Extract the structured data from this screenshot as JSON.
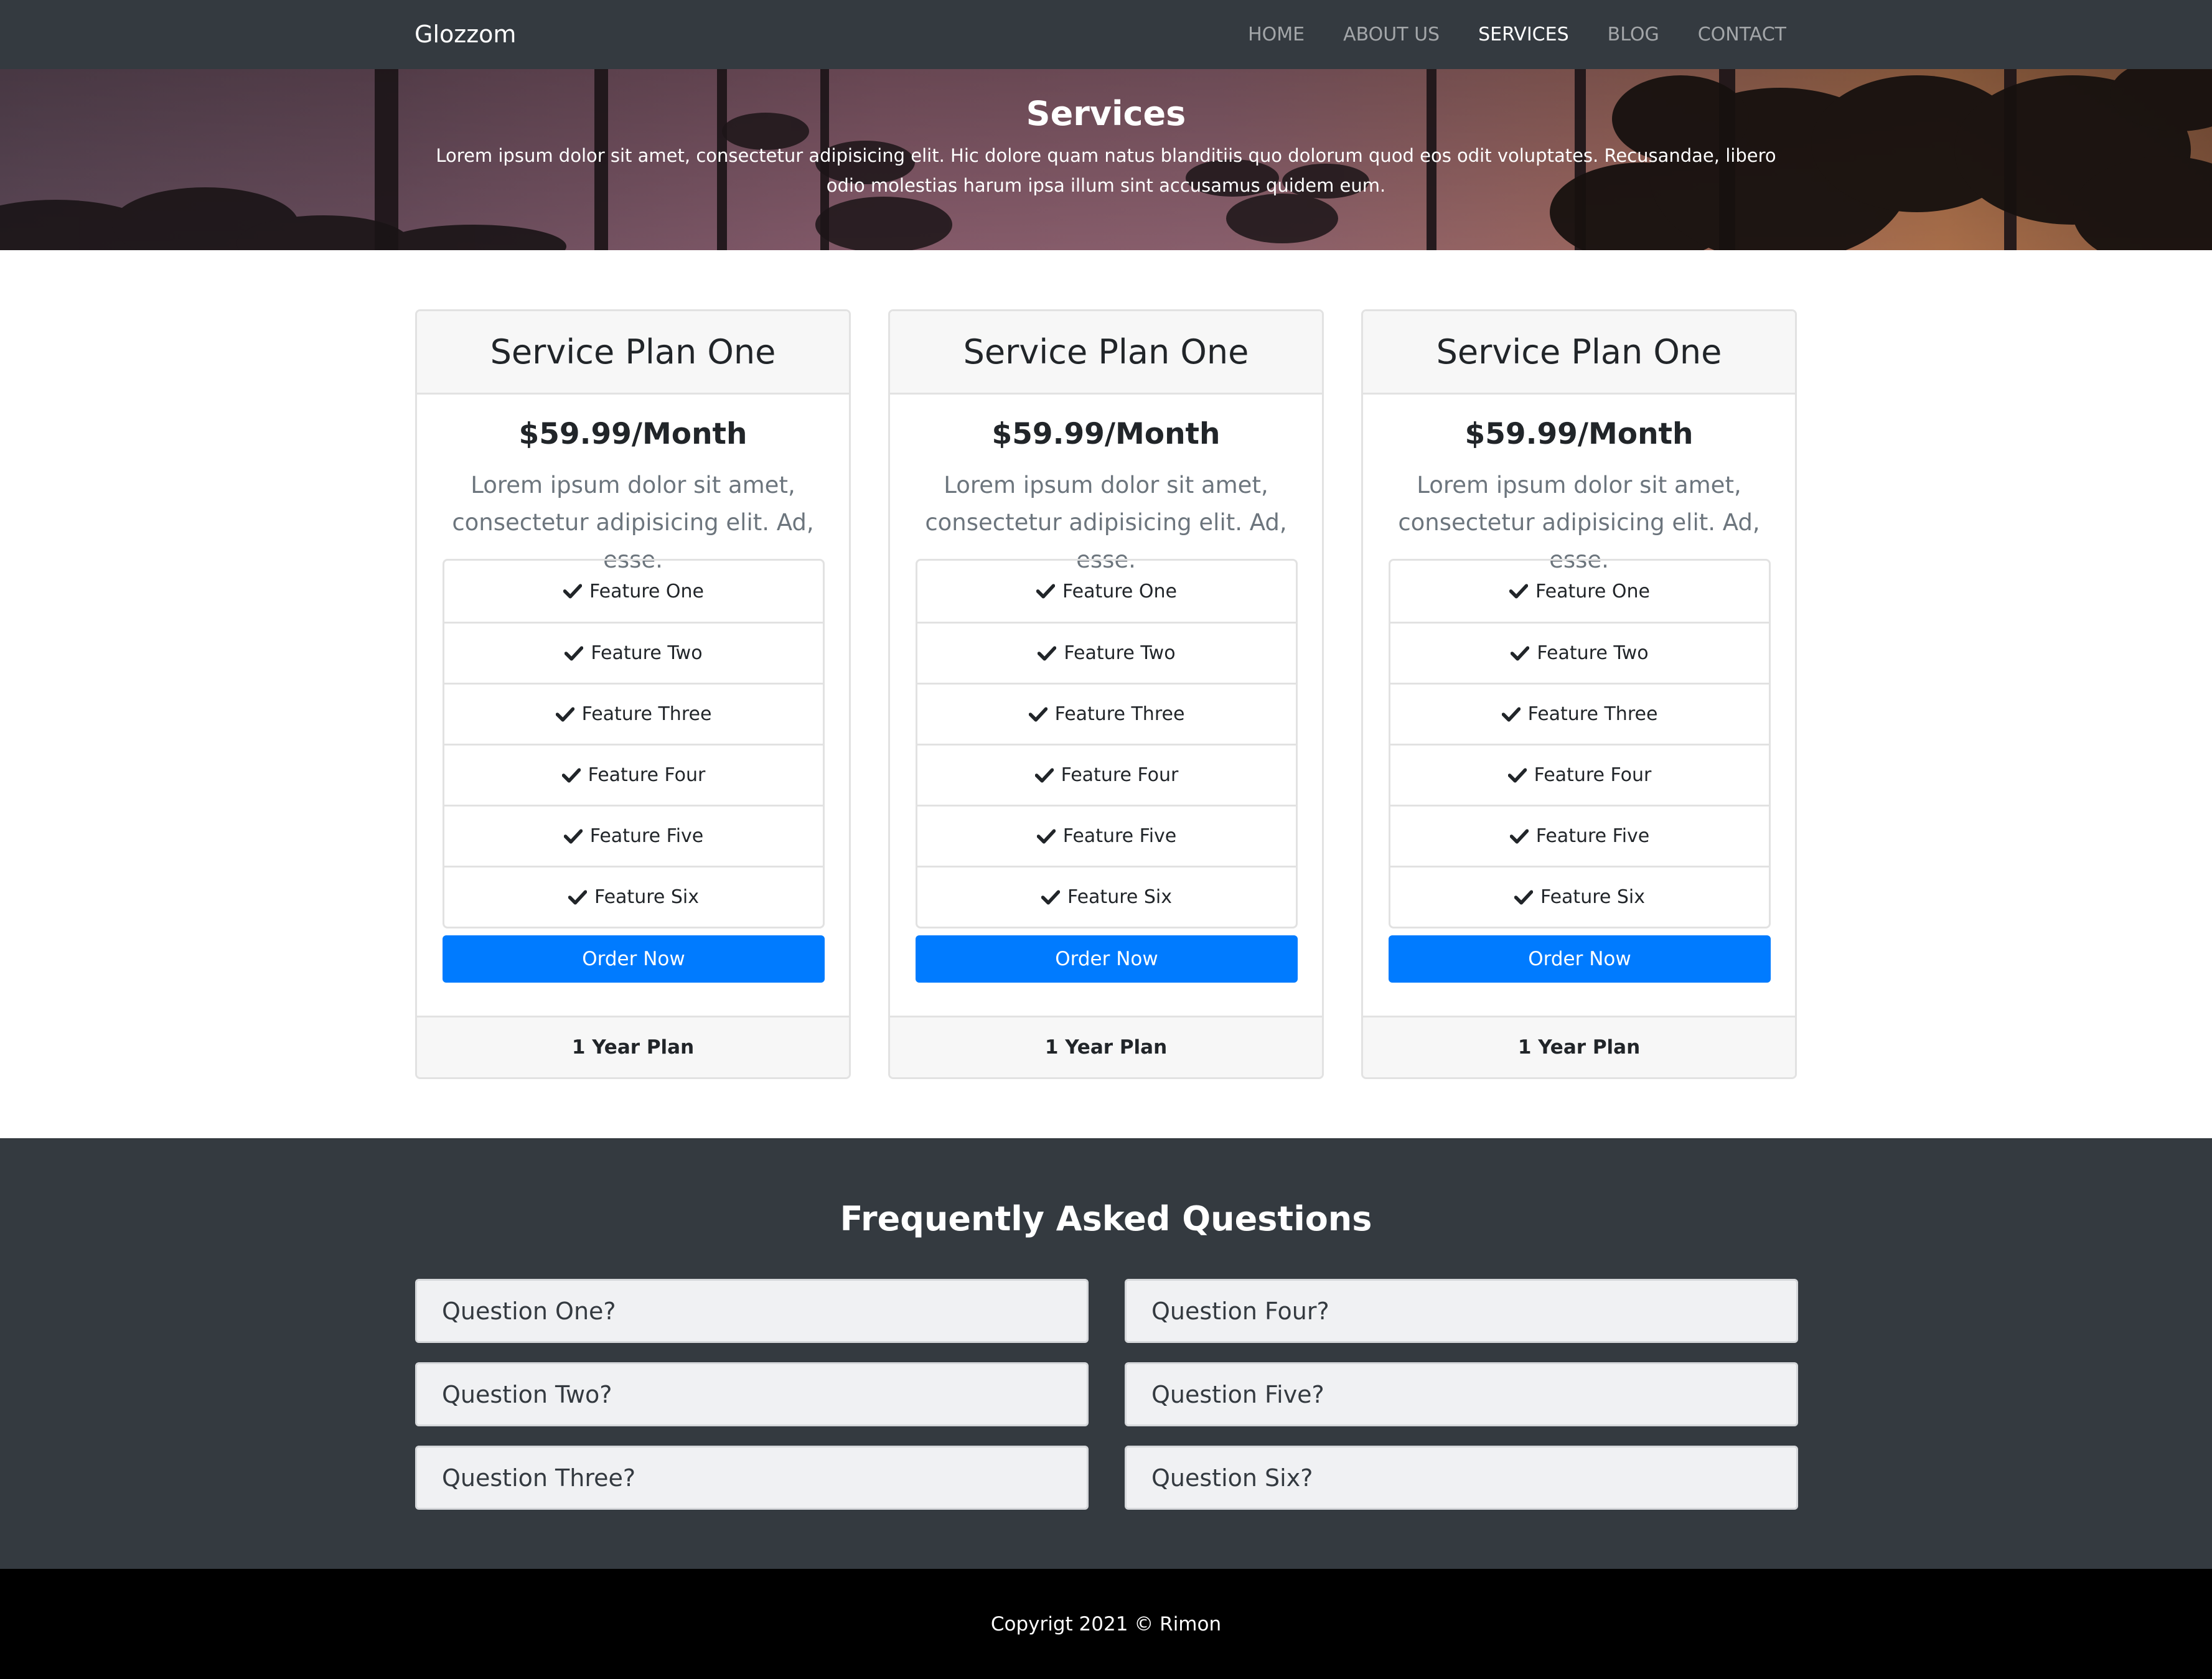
{
  "navbar": {
    "brand": "Glozzom",
    "links": [
      {
        "label": "HOME",
        "active": false
      },
      {
        "label": "ABOUT US",
        "active": false
      },
      {
        "label": "SERVICES",
        "active": true
      },
      {
        "label": "BLOG",
        "active": false
      },
      {
        "label": "CONTACT",
        "active": false
      }
    ]
  },
  "hero": {
    "title": "Services",
    "text": "Lorem ipsum dolor sit amet, consectetur adipisicing elit. Hic dolore quam natus blanditiis quo dolorum quod eos odit voluptates. Recusandae, libero odio molestias harum ipsa illum sint accusamus quidem eum."
  },
  "plans": [
    {
      "name": "Service Plan One",
      "price": "$59.99/Month",
      "description": "Lorem ipsum dolor sit amet, consectetur adipisicing elit. Ad, esse.",
      "features": [
        "Feature One",
        "Feature Two",
        "Feature Three",
        "Feature Four",
        "Feature Five",
        "Feature Six"
      ],
      "button_label": "Order Now",
      "footer": "1 Year Plan"
    },
    {
      "name": "Service Plan One",
      "price": "$59.99/Month",
      "description": "Lorem ipsum dolor sit amet, consectetur adipisicing elit. Ad, esse.",
      "features": [
        "Feature One",
        "Feature Two",
        "Feature Three",
        "Feature Four",
        "Feature Five",
        "Feature Six"
      ],
      "button_label": "Order Now",
      "footer": "1 Year Plan"
    },
    {
      "name": "Service Plan One",
      "price": "$59.99/Month",
      "description": "Lorem ipsum dolor sit amet, consectetur adipisicing elit. Ad, esse.",
      "features": [
        "Feature One",
        "Feature Two",
        "Feature Three",
        "Feature Four",
        "Feature Five",
        "Feature Six"
      ],
      "button_label": "Order Now",
      "footer": "1 Year Plan"
    }
  ],
  "faq": {
    "title": "Frequently Asked Questions",
    "questions": [
      "Question One?",
      "Question Two?",
      "Question Three?",
      "Question Four?",
      "Question Five?",
      "Question Six?"
    ]
  },
  "footer": {
    "text": "Copyrigt 2021 © Rimon"
  },
  "icons": {
    "feature": "check-icon"
  },
  "colors": {
    "navbar_bg": "#343a40",
    "primary": "#007bff",
    "faq_bg": "#343a40",
    "footer_bg": "#000000"
  }
}
